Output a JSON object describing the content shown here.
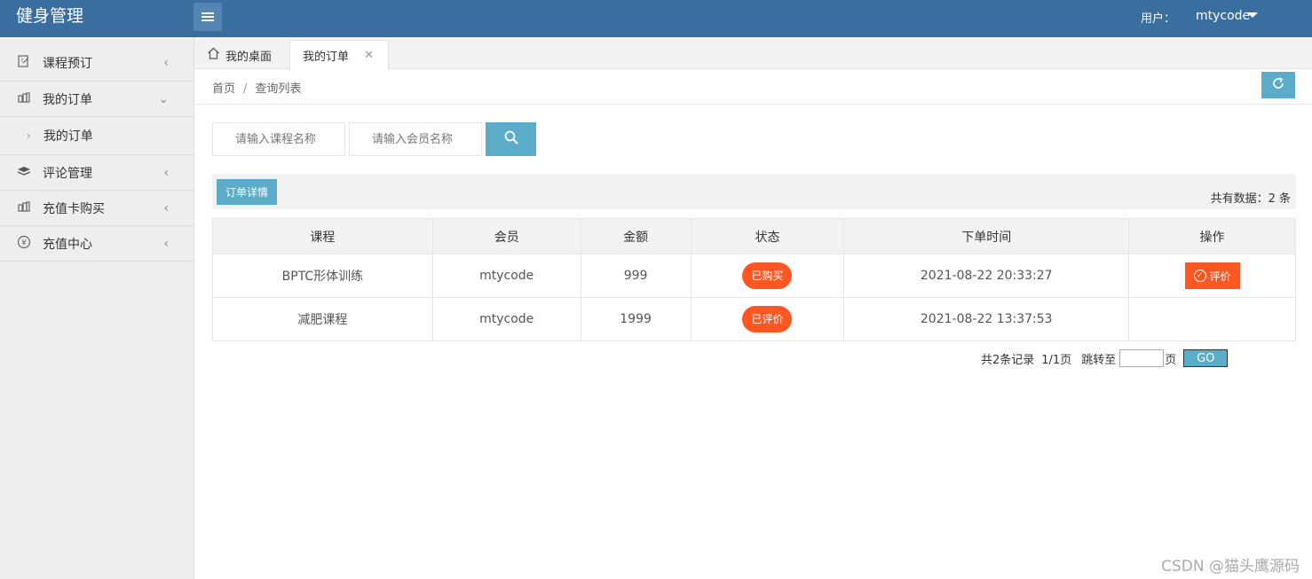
{
  "header": {
    "app_title": "健身管理",
    "user_label": "用户：",
    "user_name": "mtycode"
  },
  "sidebar": {
    "items": [
      {
        "label": "课程预订",
        "icon": "edit-icon"
      },
      {
        "label": "我的订单",
        "icon": "orders-icon",
        "expanded": true,
        "children": [
          {
            "label": "我的订单"
          }
        ]
      },
      {
        "label": "评论管理",
        "icon": "layers-icon"
      },
      {
        "label": "充值卡购买",
        "icon": "card-icon"
      },
      {
        "label": "充值中心",
        "icon": "yen-icon"
      }
    ]
  },
  "tabs": {
    "home": "我的桌面",
    "active": "我的订单"
  },
  "breadcrumb": {
    "home": "首页",
    "separator": "/",
    "current": "查询列表"
  },
  "search": {
    "course_placeholder": "请输入课程名称",
    "member_placeholder": "请输入会员名称"
  },
  "toolbar": {
    "detail_label": "订单详情",
    "total_text": "共有数据：2 条"
  },
  "table": {
    "headers": [
      "课程",
      "会员",
      "金额",
      "状态",
      "下单时间",
      "操作"
    ],
    "rows": [
      {
        "course": "BPTC形体训练",
        "member": "mtycode",
        "amount": "999",
        "status": "已购买",
        "time": "2021-08-22 20:33:27",
        "action": "评价"
      },
      {
        "course": "减肥课程",
        "member": "mtycode",
        "amount": "1999",
        "status": "已评价",
        "time": "2021-08-22 13:37:53",
        "action": ""
      }
    ]
  },
  "pager": {
    "records": "共2条记录",
    "pages": "1/1页",
    "jump_label": "跳转至",
    "page_unit": "页",
    "go_label": "GO"
  },
  "watermark": "CSDN @猫头鹰源码",
  "colors": {
    "header_bg": "#3a6e9f",
    "accent": "#5bacc9",
    "status_orange": "#ff5722"
  }
}
